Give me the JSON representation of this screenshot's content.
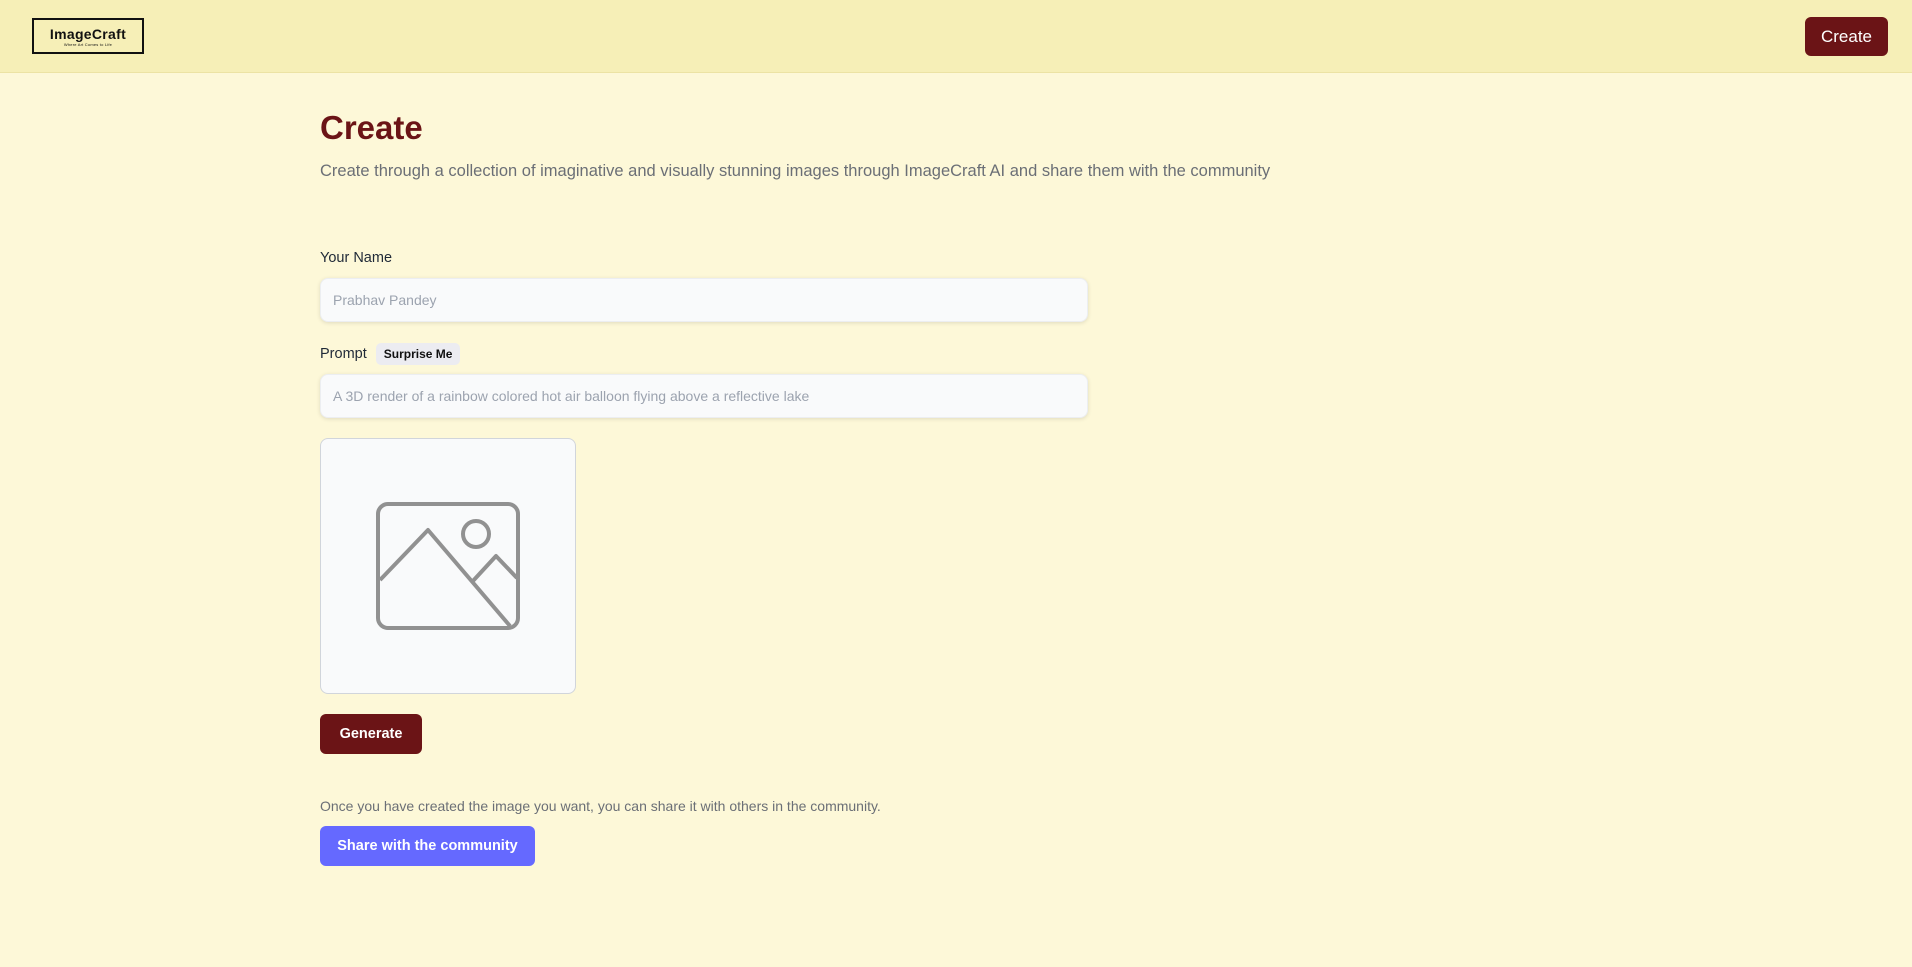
{
  "header": {
    "logo_title": "ImageCraft",
    "logo_tagline": "Where Art Comes to Life",
    "create_label": "Create"
  },
  "page": {
    "title": "Create",
    "subtitle": "Create through a collection of imaginative and visually stunning images through ImageCraft AI and share them with the community"
  },
  "form": {
    "name_label": "Your Name",
    "name_placeholder": "Prabhav Pandey",
    "prompt_label": "Prompt",
    "surprise_label": "Surprise Me",
    "prompt_placeholder": "A 3D render of a rainbow colored hot air balloon flying above a reflective lake",
    "preview_icon": "image-placeholder-icon",
    "generate_label": "Generate"
  },
  "share": {
    "note": "Once you have created the image you want, you can share it with others in the community.",
    "button_label": "Share with the community"
  },
  "colors": {
    "header_bg": "#f6efb7",
    "page_bg": "#fdf8d8",
    "brand_maroon": "#6b1416",
    "share_accent": "#6569ff"
  }
}
